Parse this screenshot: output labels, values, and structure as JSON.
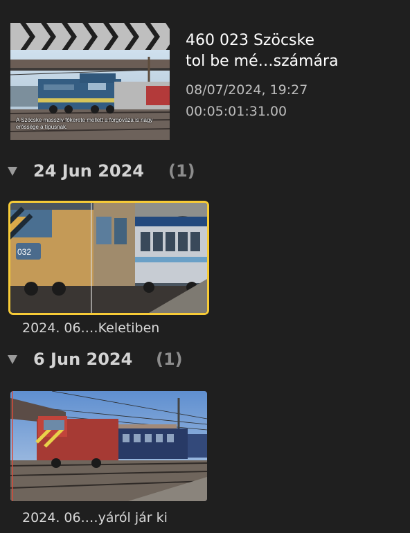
{
  "project": {
    "title_line1": "460 023 Szöcske",
    "title_line2": "tol be mé…számára",
    "date": "08/07/2024, 19:27",
    "duration": "00:05:01:31.00",
    "thumbnail_caption": "A Szöcske masszív főkerete mellett a forgóváza is nagy erőssége a típusnak."
  },
  "events": [
    {
      "date": "24 Jun 2024",
      "count": "(1)",
      "clips": [
        {
          "name": "2024. 06.…Keletiben",
          "selected": true,
          "number_plate": "032"
        }
      ]
    },
    {
      "date": "6 Jun 2024",
      "count": "(1)",
      "clips": [
        {
          "name": "2024. 06.…yáról jár ki",
          "selected": false
        }
      ]
    }
  ],
  "colors": {
    "background": "#1f1f1f",
    "selection": "#f7cb37",
    "text_primary": "#ffffff",
    "text_secondary": "#bdbdbd"
  }
}
